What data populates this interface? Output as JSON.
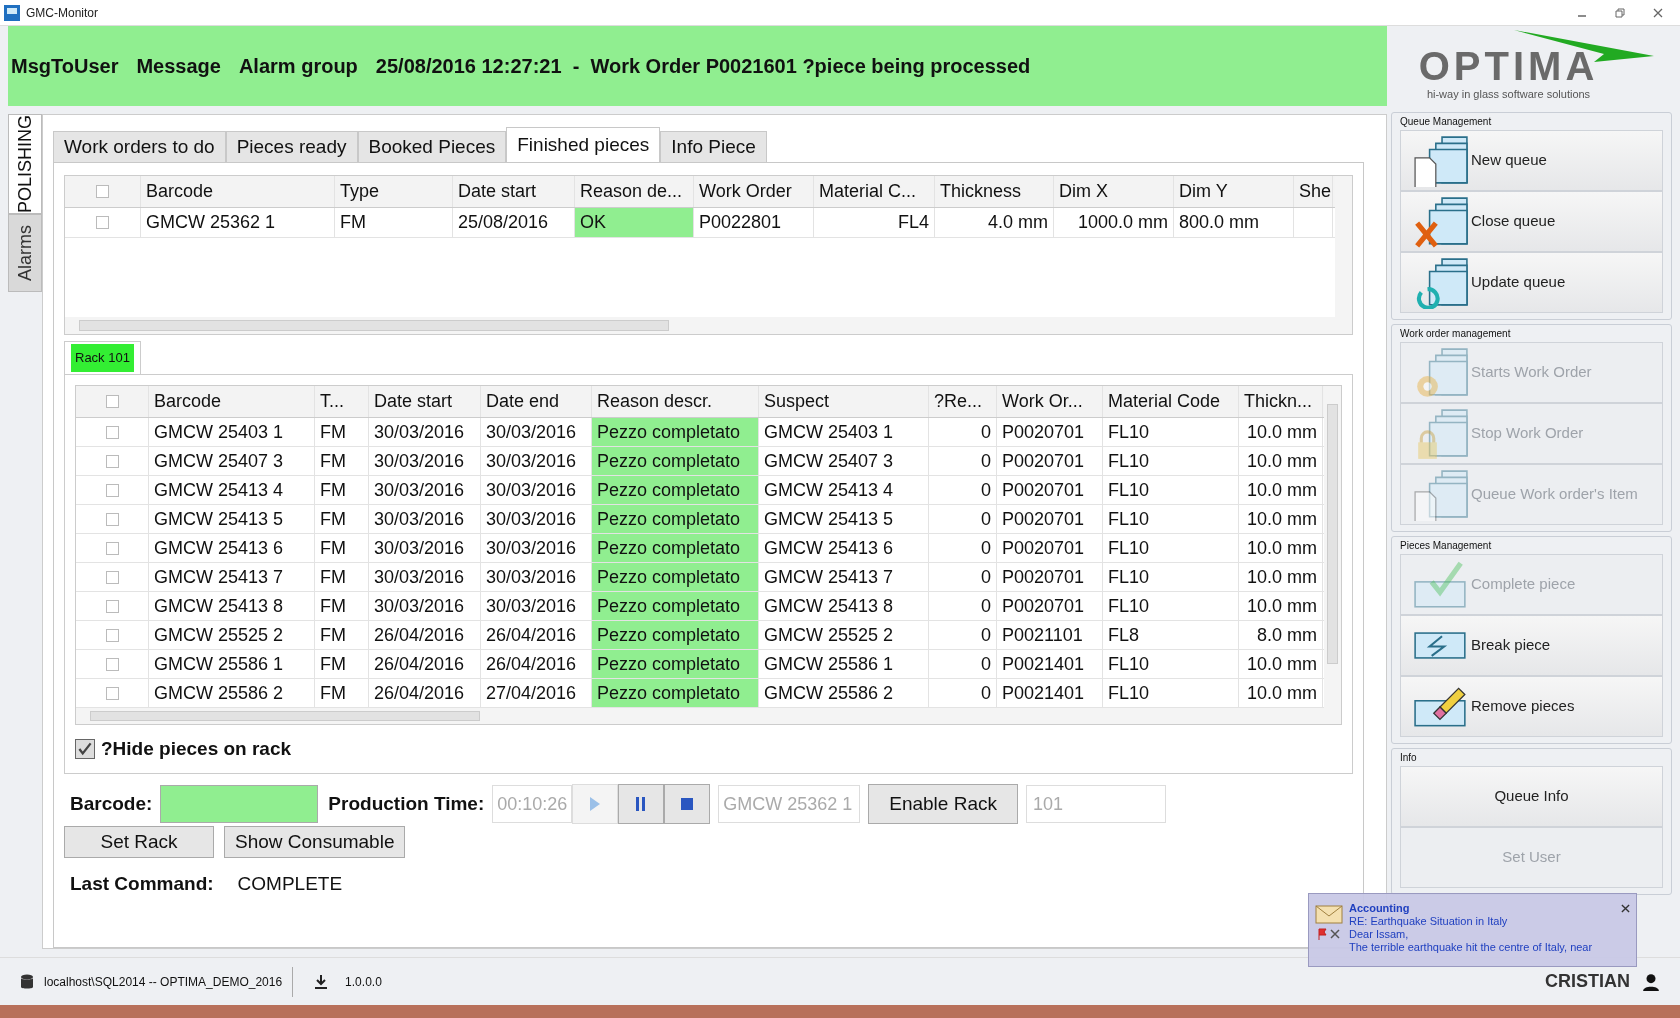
{
  "window": {
    "title": "GMC-Monitor"
  },
  "header": {
    "parts": [
      "MsgToUser",
      "Message",
      "Alarm group",
      "25/08/2016 12:27:21  -  Work Order P0021601 ?piece being processed"
    ]
  },
  "logo": {
    "name": "OPTIMA",
    "tagline": "hi-way in glass software solutions"
  },
  "side_tabs": [
    {
      "label": "POLISHING",
      "selected": true
    },
    {
      "label": "Alarms",
      "selected": false
    }
  ],
  "tabs": [
    {
      "label": "Work orders to do",
      "selected": false
    },
    {
      "label": "Pieces ready",
      "selected": false
    },
    {
      "label": "Booked Pieces",
      "selected": false
    },
    {
      "label": "Finished pieces",
      "selected": true
    },
    {
      "label": "Info Piece",
      "selected": false
    }
  ],
  "finished_table": {
    "select_all_checked": false,
    "columns": [
      "Barcode",
      "Type",
      "Date start",
      "Reason de...",
      "Work Order",
      "Material C...",
      "Thickness",
      "Dim X",
      "Dim Y",
      "She"
    ],
    "rows": [
      {
        "checked": false,
        "highlighted": true,
        "cells": [
          "GMCW 25362 1",
          "FM",
          "25/08/2016",
          "OK",
          "P0022801",
          "FL4",
          "4.0 mm",
          "1000.0 mm",
          "800.0 mm",
          ""
        ]
      }
    ]
  },
  "rack_tab": {
    "label": "Rack 101"
  },
  "rack_table": {
    "select_all_checked": false,
    "columns": [
      "Barcode",
      "T...",
      "Date start",
      "Date end",
      "Reason descr.",
      "Suspect",
      "?Re...",
      "Work Or...",
      "Material Code",
      "Thickn..."
    ],
    "rows": [
      {
        "checked": false,
        "highlighted": true,
        "cells": [
          "GMCW 25403 1",
          "FM",
          "30/03/2016",
          "30/03/2016",
          "Pezzo completato",
          "GMCW 25403 1",
          "0",
          "P0020701",
          "FL10",
          "10.0 mm"
        ]
      },
      {
        "checked": false,
        "highlighted": true,
        "cells": [
          "GMCW 25407 3",
          "FM",
          "30/03/2016",
          "30/03/2016",
          "Pezzo completato",
          "GMCW 25407 3",
          "0",
          "P0020701",
          "FL10",
          "10.0 mm"
        ]
      },
      {
        "checked": false,
        "highlighted": true,
        "cells": [
          "GMCW 25413 4",
          "FM",
          "30/03/2016",
          "30/03/2016",
          "Pezzo completato",
          "GMCW 25413 4",
          "0",
          "P0020701",
          "FL10",
          "10.0 mm"
        ]
      },
      {
        "checked": false,
        "highlighted": true,
        "cells": [
          "GMCW 25413 5",
          "FM",
          "30/03/2016",
          "30/03/2016",
          "Pezzo completato",
          "GMCW 25413 5",
          "0",
          "P0020701",
          "FL10",
          "10.0 mm"
        ]
      },
      {
        "checked": false,
        "highlighted": true,
        "cells": [
          "GMCW 25413 6",
          "FM",
          "30/03/2016",
          "30/03/2016",
          "Pezzo completato",
          "GMCW 25413 6",
          "0",
          "P0020701",
          "FL10",
          "10.0 mm"
        ]
      },
      {
        "checked": false,
        "highlighted": true,
        "cells": [
          "GMCW 25413 7",
          "FM",
          "30/03/2016",
          "30/03/2016",
          "Pezzo completato",
          "GMCW 25413 7",
          "0",
          "P0020701",
          "FL10",
          "10.0 mm"
        ]
      },
      {
        "checked": false,
        "highlighted": true,
        "cells": [
          "GMCW 25413 8",
          "FM",
          "30/03/2016",
          "30/03/2016",
          "Pezzo completato",
          "GMCW 25413 8",
          "0",
          "P0020701",
          "FL10",
          "10.0 mm"
        ]
      },
      {
        "checked": false,
        "highlighted": true,
        "cells": [
          "GMCW 25525 2",
          "FM",
          "26/04/2016",
          "26/04/2016",
          "Pezzo completato",
          "GMCW 25525 2",
          "0",
          "P0021101",
          "FL8",
          "8.0 mm"
        ]
      },
      {
        "checked": false,
        "highlighted": true,
        "cells": [
          "GMCW 25586 1",
          "FM",
          "26/04/2016",
          "26/04/2016",
          "Pezzo completato",
          "GMCW 25586 1",
          "0",
          "P0021401",
          "FL10",
          "10.0 mm"
        ]
      },
      {
        "checked": false,
        "highlighted": true,
        "cells": [
          "GMCW 25586 2",
          "FM",
          "26/04/2016",
          "27/04/2016",
          "Pezzo completato",
          "GMCW 25586 2",
          "0",
          "P0021401",
          "FL10",
          "10.0 mm"
        ]
      }
    ]
  },
  "hide_pieces": {
    "label": "?Hide pieces on rack",
    "checked": true
  },
  "form": {
    "barcode_label": "Barcode:",
    "production_label": "Production Time:",
    "production_time": "00:10:26",
    "current_barcode": "GMCW 25362 1",
    "enable_rack": "Enable Rack",
    "rack_value": "101",
    "set_rack": "Set Rack",
    "show_consumable": "Show Consumable",
    "last_command_label": "Last Command:",
    "last_command": "COMPLETE"
  },
  "side_groups": [
    {
      "title": "Queue Management",
      "buttons": [
        {
          "label": "New queue",
          "kind": "new",
          "disabled": false
        },
        {
          "label": "Close queue",
          "kind": "close",
          "disabled": false
        },
        {
          "label": "Update queue",
          "kind": "update",
          "disabled": false
        }
      ]
    },
    {
      "title": "Work order management",
      "buttons": [
        {
          "label": "Starts Work Order",
          "kind": "gear",
          "disabled": true
        },
        {
          "label": "Stop Work Order",
          "kind": "lock",
          "disabled": true
        },
        {
          "label": "Queue Work order's Item",
          "kind": "new",
          "disabled": true
        }
      ]
    },
    {
      "title": "Pieces Management",
      "buttons": [
        {
          "label": "Complete piece",
          "kind": "check",
          "disabled": true
        },
        {
          "label": "Break piece",
          "kind": "break",
          "disabled": false
        },
        {
          "label": "Remove pieces",
          "kind": "eraser",
          "disabled": false
        }
      ]
    },
    {
      "title": "Info",
      "buttons": [
        {
          "label": "Queue Info",
          "kind": "text",
          "disabled": false
        },
        {
          "label": "Set User",
          "kind": "text",
          "disabled": true
        }
      ]
    }
  ],
  "notification": {
    "sender": "Accounting",
    "subject": "RE: Earthquake Situation in Italy",
    "line_1": "Dear Issam,",
    "line_2": "The terrible earthquake hit the centre of Italy, near"
  },
  "status_bar": {
    "database": "localhost\\SQL2014 -- OPTIMA_DEMO_2016",
    "version": "1.0.0.0",
    "user": "CRISTIAN"
  }
}
